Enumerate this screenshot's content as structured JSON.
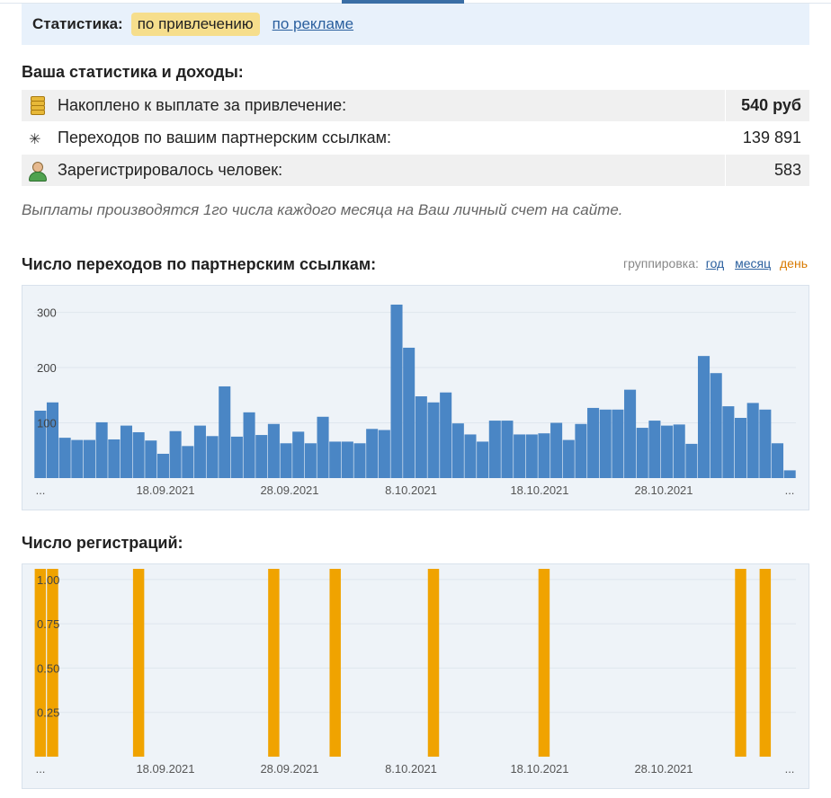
{
  "stat_bar": {
    "label": "Статистика:",
    "active_tab": "по привлечению",
    "link": "по рекламе"
  },
  "summary": {
    "heading": "Ваша статистика и доходы:",
    "rows": [
      {
        "icon": "coins-icon",
        "label": "Накоплено к выплате за привлечение:",
        "value": "540 руб"
      },
      {
        "icon": "cursor-click-icon",
        "label": "Переходов по вашим партнерским ссылкам:",
        "value": "139 891"
      },
      {
        "icon": "user-icon",
        "label": "Зарегистрировалось человек:",
        "value": "583"
      }
    ],
    "note": "Выплаты производятся 1го числа каждого месяца на Ваш личный счет на сайте."
  },
  "grouping": {
    "label": "группировка:",
    "year": "год",
    "month": "месяц",
    "day": "день"
  },
  "colors": {
    "bar_blue": "#4a86c5",
    "bar_orange": "#f0a300",
    "chart_bg": "#eef3f8"
  },
  "chart_data": [
    {
      "type": "bar",
      "title": "Число переходов по партнерским ссылкам:",
      "x_tick_labels": [
        "...",
        "18.09.2021",
        "28.09.2021",
        "8.10.2021",
        "18.10.2021",
        "28.10.2021",
        "..."
      ],
      "y_ticks": [
        "100",
        "200",
        "300"
      ],
      "ylim": [
        0,
        340
      ],
      "grid": true,
      "values": [
        122,
        137,
        73,
        69,
        69,
        101,
        70,
        95,
        83,
        68,
        44,
        85,
        58,
        95,
        76,
        166,
        75,
        119,
        78,
        98,
        63,
        84,
        63,
        111,
        66,
        66,
        63,
        89,
        87,
        314,
        236,
        148,
        137,
        155,
        99,
        79,
        66,
        104,
        104,
        79,
        79,
        81,
        100,
        69,
        98,
        127,
        124,
        124,
        160,
        91,
        104,
        95,
        97,
        62,
        221,
        190,
        130,
        109,
        136,
        124,
        63,
        14
      ]
    },
    {
      "type": "bar",
      "title": "Число регистраций:",
      "x_tick_labels": [
        "...",
        "18.09.2021",
        "28.09.2021",
        "8.10.2021",
        "18.10.2021",
        "28.10.2021",
        "..."
      ],
      "y_ticks": [
        "0.25",
        "0.50",
        "0.75",
        "1.00"
      ],
      "ylim": [
        0,
        1.06
      ],
      "grid": true,
      "values": [
        1,
        1,
        0,
        0,
        0,
        0,
        0,
        0,
        1,
        0,
        0,
        0,
        0,
        0,
        0,
        0,
        0,
        0,
        0,
        1,
        0,
        0,
        0,
        0,
        1,
        0,
        0,
        0,
        0,
        0,
        0,
        0,
        1,
        0,
        0,
        0,
        0,
        0,
        0,
        0,
        0,
        1,
        0,
        0,
        0,
        0,
        0,
        0,
        0,
        0,
        0,
        0,
        0,
        0,
        0,
        0,
        0,
        1,
        0,
        1,
        0,
        0
      ]
    }
  ]
}
